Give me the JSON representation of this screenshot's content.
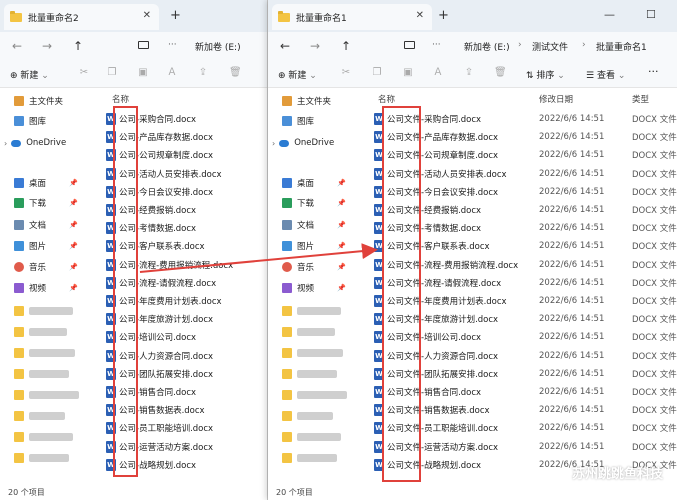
{
  "left": {
    "tab_title": "批量重命名2",
    "drive": "新加卷 (E:)",
    "new_label": "新建",
    "column_name": "名称",
    "status": "20 个项目",
    "sidebar": [
      {
        "label": "主文件夹"
      },
      {
        "label": "图库"
      },
      {
        "label": "OneDrive"
      },
      {
        "label": "桌面"
      },
      {
        "label": "下载"
      },
      {
        "label": "文档"
      },
      {
        "label": "图片"
      },
      {
        "label": "音乐"
      },
      {
        "label": "视频"
      }
    ],
    "files": [
      "公司-采购合同.docx",
      "公司-产品库存数据.docx",
      "公司-公司规章制度.docx",
      "公司-活动人员安排表.docx",
      "公司-今日会议安排.docx",
      "公司-经费报销.docx",
      "公司-考情数据.docx",
      "公司-客户联系表.docx",
      "公司-流程-费用报销流程.docx",
      "公司-流程-请假流程.docx",
      "公司-年度费用计划表.docx",
      "公司-年度旅游计划.docx",
      "公司-培训公司.docx",
      "公司-人力资源合同.docx",
      "公司-团队拓展安排.docx",
      "公司-销售合同.docx",
      "公司-销售数据表.docx",
      "公司-员工职能培训.docx",
      "公司-运营活动方案.docx",
      "公司-战略规划.docx"
    ]
  },
  "right": {
    "tab_title": "批量重命名1",
    "breadcrumb": [
      "新加卷 (E:)",
      "测试文件",
      "批量重命名1"
    ],
    "new_label": "新建",
    "sort_label": "排序",
    "view_label": "查看",
    "column_name": "名称",
    "column_date": "修改日期",
    "column_type": "类型",
    "status": "20 个项目",
    "date": "2022/6/6 14:51",
    "type": "DOCX 文件",
    "sidebar": [
      {
        "label": "主文件夹"
      },
      {
        "label": "图库"
      },
      {
        "label": "OneDrive"
      },
      {
        "label": "桌面"
      },
      {
        "label": "下载"
      },
      {
        "label": "文档"
      },
      {
        "label": "图片"
      },
      {
        "label": "音乐"
      },
      {
        "label": "视频"
      }
    ],
    "files": [
      "公司文件-采购合同.docx",
      "公司文件-产品库存数据.docx",
      "公司文件-公司规章制度.docx",
      "公司文件-活动人员安排表.docx",
      "公司文件-今日会议安排.docx",
      "公司文件-经费报销.docx",
      "公司文件-考情数据.docx",
      "公司文件-客户联系表.docx",
      "公司文件-流程-费用报销流程.docx",
      "公司文件-流程-请假流程.docx",
      "公司文件-年度费用计划表.docx",
      "公司文件-年度旅游计划.docx",
      "公司文件-培训公司.docx",
      "公司文件-人力资源合同.docx",
      "公司文件-团队拓展安排.docx",
      "公司文件-销售合同.docx",
      "公司文件-销售数据表.docx",
      "公司文件-员工职能培训.docx",
      "公司文件-运营活动方案.docx",
      "公司文件-战略规划.docx"
    ]
  },
  "watermark": "苏州跳跳鱼科技",
  "colors": {
    "accent_red": "#e0413b",
    "word_blue": "#2b5fb4",
    "folder_yellow": "#f3c443"
  }
}
